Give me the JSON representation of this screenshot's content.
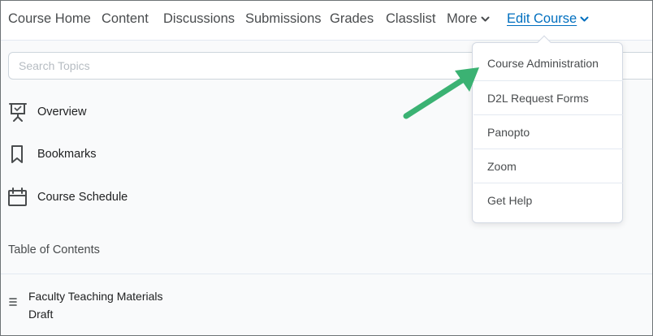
{
  "nav": {
    "items": [
      {
        "label": "Course Home"
      },
      {
        "label": "Content"
      },
      {
        "label": "Discussions"
      },
      {
        "label": "Submissions"
      },
      {
        "label": "Grades"
      },
      {
        "label": "Classlist"
      },
      {
        "label": "More"
      },
      {
        "label": "Edit Course"
      }
    ]
  },
  "search": {
    "placeholder": "Search Topics"
  },
  "sidebar": {
    "items": [
      {
        "label": "Overview",
        "icon": "presentation-board-icon"
      },
      {
        "label": "Bookmarks",
        "icon": "bookmark-icon"
      },
      {
        "label": "Course Schedule",
        "icon": "calendar-icon"
      }
    ]
  },
  "toc": {
    "heading": "Table of Contents",
    "modules": [
      {
        "title": "Faculty Teaching Materials",
        "status": "Draft"
      }
    ]
  },
  "edit_course_menu": {
    "items": [
      {
        "label": "Course Administration"
      },
      {
        "label": "D2L Request Forms"
      },
      {
        "label": "Panopto"
      },
      {
        "label": "Zoom"
      },
      {
        "label": "Get Help"
      }
    ]
  },
  "colors": {
    "accent": "#006fbf",
    "arrow": "#3bb273",
    "text": "#494c4e",
    "background": "#f9fafb"
  }
}
